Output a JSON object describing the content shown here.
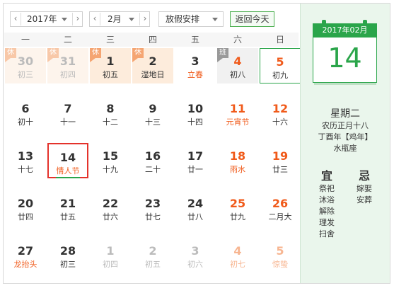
{
  "toolbar": {
    "year": "2017年",
    "month": "2月",
    "holiday_select": "放假安排",
    "today_button": "返回今天",
    "prev_arrow": "‹",
    "next_arrow": "›"
  },
  "weekdays": [
    "一",
    "二",
    "三",
    "四",
    "五",
    "六",
    "日"
  ],
  "weeks": [
    [
      {
        "num": "30",
        "lunar": "初三",
        "other": true,
        "badge": "休",
        "badge_type": "rest",
        "holiday": true
      },
      {
        "num": "31",
        "lunar": "初四",
        "other": true,
        "badge": "休",
        "badge_type": "rest",
        "holiday": true
      },
      {
        "num": "1",
        "lunar": "初五",
        "badge": "休",
        "badge_type": "rest",
        "holiday": true
      },
      {
        "num": "2",
        "lunar": "湿地日",
        "badge": "休",
        "badge_type": "rest",
        "holiday": true
      },
      {
        "num": "3",
        "lunar": "立春",
        "festival": true
      },
      {
        "num": "4",
        "lunar": "初八",
        "red": true,
        "badge": "班",
        "badge_type": "work",
        "workday": true
      },
      {
        "num": "5",
        "lunar": "初九",
        "red": true,
        "today": true
      }
    ],
    [
      {
        "num": "6",
        "lunar": "初十"
      },
      {
        "num": "7",
        "lunar": "十一"
      },
      {
        "num": "8",
        "lunar": "十二"
      },
      {
        "num": "9",
        "lunar": "十三"
      },
      {
        "num": "10",
        "lunar": "十四"
      },
      {
        "num": "11",
        "lunar": "元宵节",
        "red": true,
        "festival": true
      },
      {
        "num": "12",
        "lunar": "十六",
        "red": true
      }
    ],
    [
      {
        "num": "13",
        "lunar": "十七"
      },
      {
        "num": "14",
        "lunar": "情人节",
        "selected": true
      },
      {
        "num": "15",
        "lunar": "十九"
      },
      {
        "num": "16",
        "lunar": "二十"
      },
      {
        "num": "17",
        "lunar": "廿一"
      },
      {
        "num": "18",
        "lunar": "雨水",
        "red": true,
        "festival": true
      },
      {
        "num": "19",
        "lunar": "廿三",
        "red": true
      }
    ],
    [
      {
        "num": "20",
        "lunar": "廿四"
      },
      {
        "num": "21",
        "lunar": "廿五"
      },
      {
        "num": "22",
        "lunar": "廿六"
      },
      {
        "num": "23",
        "lunar": "廿七"
      },
      {
        "num": "24",
        "lunar": "廿八"
      },
      {
        "num": "25",
        "lunar": "廿九",
        "red": true
      },
      {
        "num": "26",
        "lunar": "二月大",
        "red": true
      }
    ],
    [
      {
        "num": "27",
        "lunar": "龙抬头",
        "festival": true
      },
      {
        "num": "28",
        "lunar": "初三"
      },
      {
        "num": "1",
        "lunar": "初四",
        "other": true
      },
      {
        "num": "2",
        "lunar": "初五",
        "other": true
      },
      {
        "num": "3",
        "lunar": "初六",
        "other": true
      },
      {
        "num": "4",
        "lunar": "初七",
        "other": true,
        "red": true
      },
      {
        "num": "5",
        "lunar": "惊蛰",
        "other": true,
        "red": true
      }
    ]
  ],
  "side": {
    "header": "2017年02月",
    "day": "14",
    "weekday": "星期二",
    "lunar_date": "农历正月十八",
    "ganzhi": "丁酉年【鸡年】",
    "constellation": "水瓶座",
    "yi_title": "宜",
    "ji_title": "忌",
    "yi_items": [
      "祭祀",
      "沐浴",
      "解除",
      "理发",
      "扫舍"
    ],
    "ji_items": [
      "嫁娶",
      "安葬"
    ]
  },
  "colors": {
    "accent_green": "#2aa54a",
    "holiday_orange": "#f05a1a",
    "selected_border": "#e4322b"
  }
}
